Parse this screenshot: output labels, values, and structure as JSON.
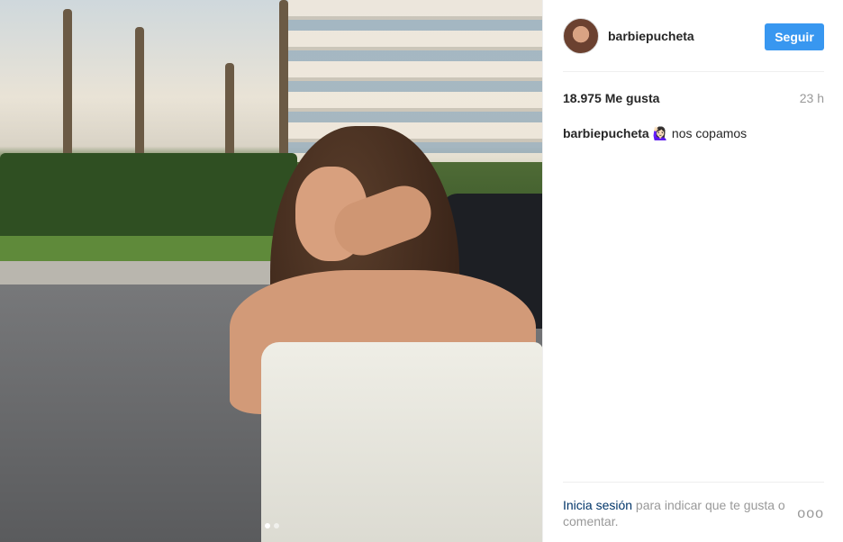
{
  "post": {
    "username": "barbiepucheta",
    "follow_label": "Seguir",
    "likes": "18.975 Me gusta",
    "time": "23 h",
    "caption_user": "barbiepucheta",
    "caption_text": " 🙋🏻‍♀️ nos copamos",
    "login_link": "Inicia sesión",
    "login_rest": " para indicar que te gusta o comentar.",
    "more_label": "ooo",
    "carousel_count": 2,
    "carousel_active": 1
  },
  "colors": {
    "accent": "#3897f0",
    "link": "#003569",
    "muted": "#999999"
  },
  "icons": {
    "more": "more-options-icon"
  }
}
